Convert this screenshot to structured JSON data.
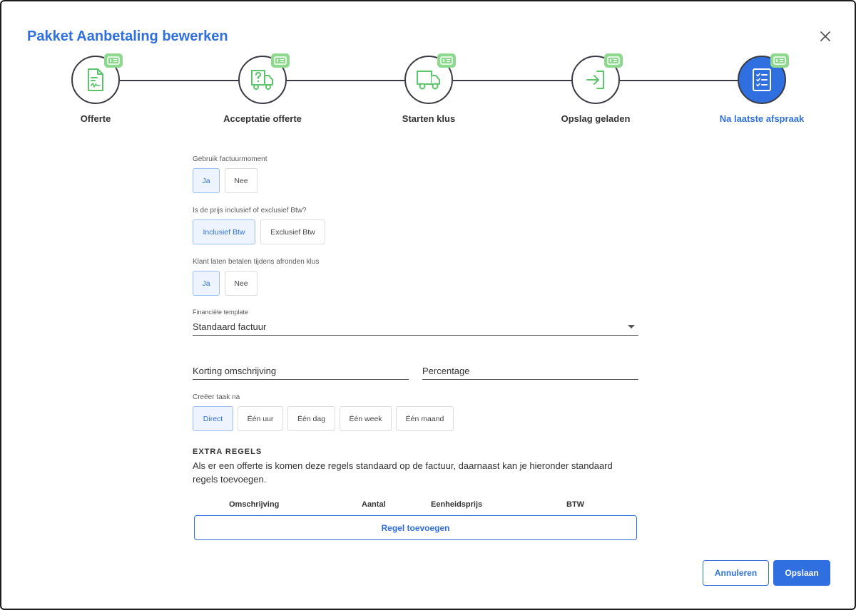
{
  "dialog": {
    "title": "Pakket Aanbetaling bewerken",
    "close_icon": "close-icon"
  },
  "stepper": {
    "steps": [
      {
        "label": "Offerte",
        "icon": "document-signature-icon",
        "badge_icon": "money-bill-icon",
        "active": false
      },
      {
        "label": "Acceptatie offerte",
        "icon": "question-truck-icon",
        "badge_icon": "money-bill-icon",
        "active": false
      },
      {
        "label": "Starten klus",
        "icon": "truck-icon",
        "badge_icon": "money-bill-icon",
        "active": false
      },
      {
        "label": "Opslag geladen",
        "icon": "sign-in-arrow-icon",
        "badge_icon": "money-bill-icon",
        "active": false
      },
      {
        "label": "Na laatste afspraak",
        "icon": "checklist-icon",
        "badge_icon": "money-bill-icon",
        "active": true
      }
    ]
  },
  "form": {
    "use_invoice_moment": {
      "label": "Gebruik factuurmoment",
      "options": [
        "Ja",
        "Nee"
      ],
      "selected": "Ja"
    },
    "vat_mode": {
      "label": "Is de prijs inclusief of exclusief Btw?",
      "options": [
        "Inclusief Btw",
        "Exclusief Btw"
      ],
      "selected": "Inclusief Btw"
    },
    "pay_on_finish": {
      "label": "Klant laten betalen tijdens afronden klus",
      "options": [
        "Ja",
        "Nee"
      ],
      "selected": "Ja"
    },
    "financial_template": {
      "label": "Financiële template",
      "value": "Standaard factuur"
    },
    "discount_description": {
      "placeholder": "Korting omschrijving",
      "value": ""
    },
    "percentage": {
      "placeholder": "Percentage",
      "value": ""
    },
    "create_task_after": {
      "label": "Creëer taak na",
      "options": [
        "Direct",
        "Één uur",
        "Één dag",
        "Één week",
        "Één maand"
      ],
      "selected": "Direct"
    }
  },
  "extra_rules": {
    "title": "EXTRA REGELS",
    "description": "Als er een offerte is komen deze regels standaard op de factuur, daarnaast kan je hieronder standaard regels toevoegen.",
    "columns": [
      "Omschrijving",
      "Aantal",
      "Eenheidsprijs",
      "BTW"
    ],
    "add_button": "Regel toevoegen"
  },
  "footer": {
    "cancel": "Annuleren",
    "save": "Opslaan"
  },
  "colors": {
    "accent": "#2f6fe0",
    "badge": "#8fd88f",
    "icon_green": "#5cc46b"
  }
}
